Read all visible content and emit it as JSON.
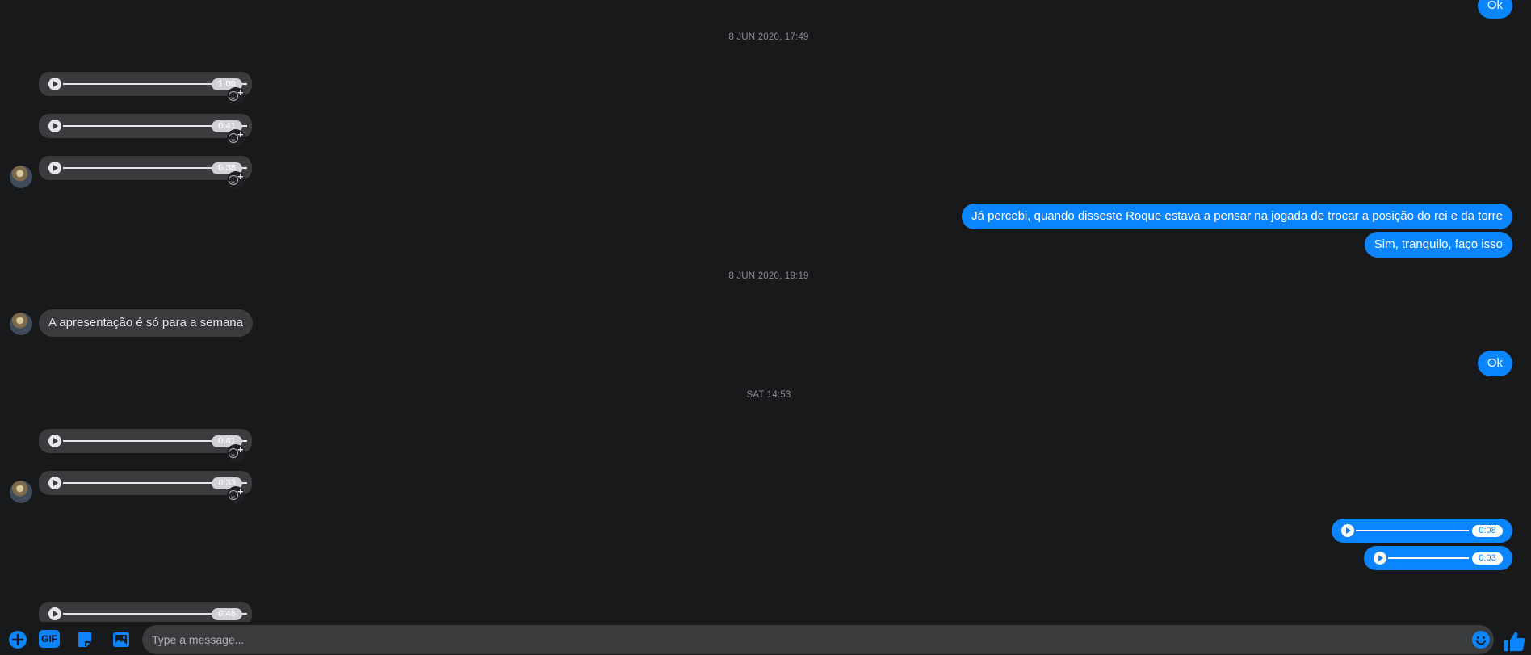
{
  "conversation": {
    "top_reply": "Ok",
    "timestamps": [
      "8 JUN 2020, 17:49",
      "8 JUN 2020, 19:19",
      "SAT 14:53"
    ],
    "audio_incoming_1": [
      "1:00",
      "0:41",
      "0:38"
    ],
    "sent_messages": [
      "Já percebi, quando disseste Roque estava a pensar na jogada de trocar a posição do rei e da torre",
      "Sim, tranquilo, faço isso"
    ],
    "received_message": "A apresentação é só para a semana",
    "reply_ok": "Ok",
    "audio_incoming_2": [
      "0:41",
      "0:33",
      "0:48"
    ],
    "audio_outgoing": [
      "0:08",
      "0:03"
    ]
  },
  "composer": {
    "placeholder": "Type a message...",
    "gif_label": "GIF"
  },
  "colors": {
    "background": "#18191a",
    "bubble_in": "#3a3b3c",
    "bubble_out": "#0a84ff",
    "text": "#e4e6eb"
  },
  "icons": {
    "add": "plus-circle-icon",
    "gif": "gif-icon",
    "sticker": "sticker-icon",
    "photo": "photo-icon",
    "emoji": "smile-emoji-icon",
    "like": "thumbs-up-icon"
  }
}
